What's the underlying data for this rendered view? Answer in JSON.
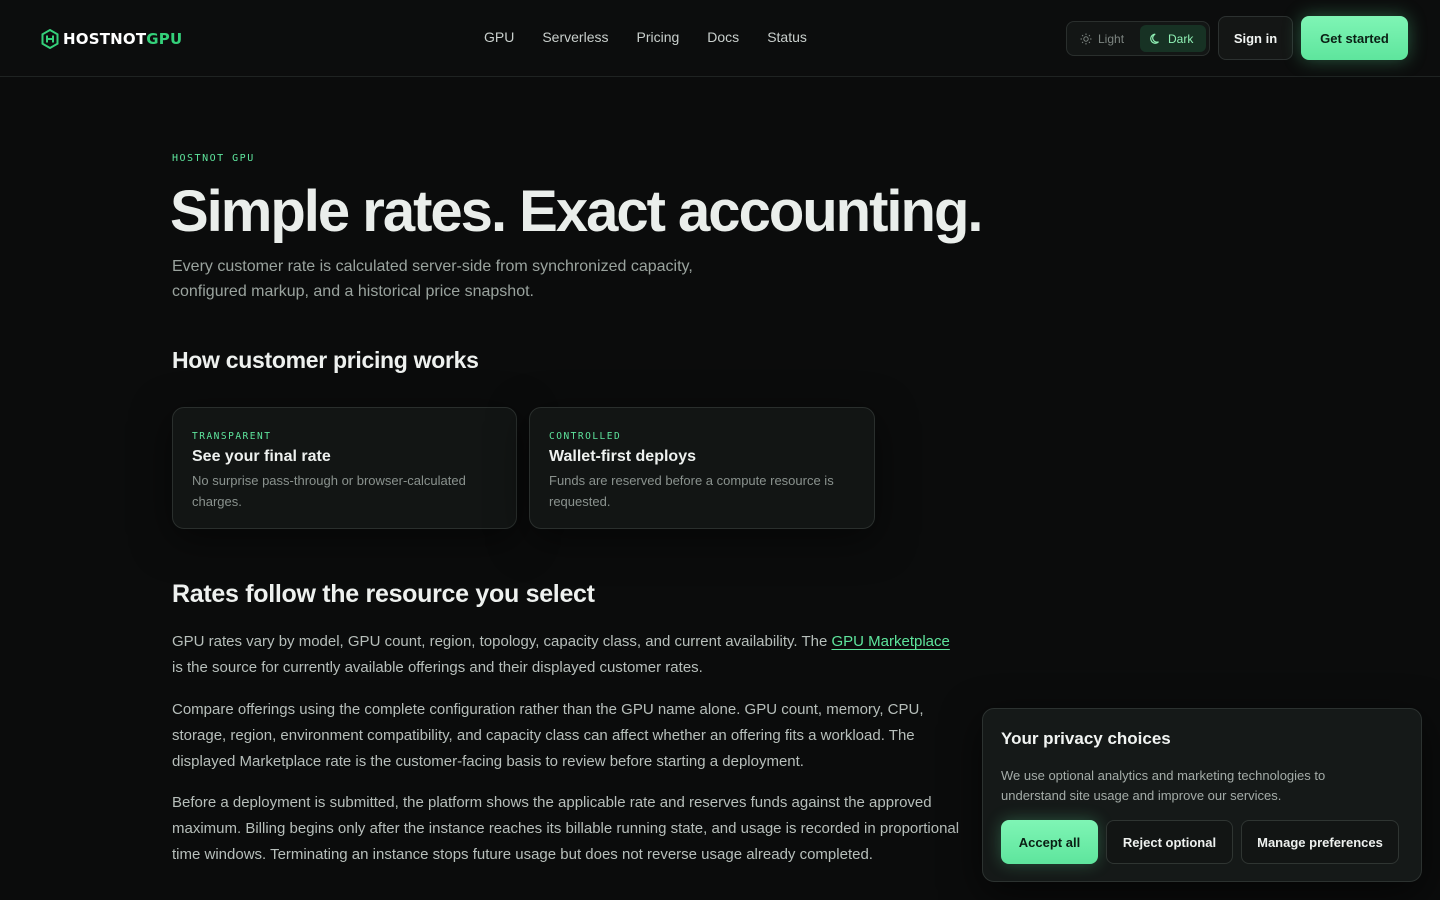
{
  "header": {
    "logo": {
      "part1": "HOSTNOT",
      "part2": "GPU",
      "icon": "hexagon-logo-icon"
    },
    "nav": [
      "GPU",
      "Serverless",
      "Pricing",
      "Docs",
      "Status"
    ],
    "theme": {
      "light_label": "Light",
      "dark_label": "Dark",
      "selected": "Dark"
    },
    "sign_in": "Sign in",
    "get_started": "Get started"
  },
  "hero": {
    "eyebrow": "HOSTNOT GPU",
    "title": "Simple rates. Exact accounting.",
    "lead": "Every customer rate is calculated server-side from synchronized capacity, configured markup, and a historical price snapshot."
  },
  "how": {
    "heading": "How customer pricing works",
    "cards": [
      {
        "tag": "TRANSPARENT",
        "title": "See your final rate",
        "desc": "No surprise pass-through or browser-calculated charges."
      },
      {
        "tag": "CONTROLLED",
        "title": "Wallet-first deploys",
        "desc": "Funds are reserved before a compute resource is requested."
      }
    ]
  },
  "rates": {
    "heading": "Rates follow the resource you select",
    "p1_before": "GPU rates vary by model, GPU count, region, topology, capacity class, and current availability. The ",
    "p1_link": "GPU Marketplace",
    "p1_after": " is the source for currently available offerings and their displayed customer rates.",
    "p2": "Compare offerings using the complete configuration rather than the GPU name alone. GPU count, memory, CPU, storage, region, environment compatibility, and capacity class can affect whether an offering fits a workload. The displayed Marketplace rate is the customer-facing basis to review before starting a deployment.",
    "p3": "Before a deployment is submitted, the platform shows the applicable rate and reserves funds against the approved maximum. Billing begins only after the instance reaches its billable running state, and usage is recorded in proportional time windows. Terminating an instance stops future usage but does not reverse usage already completed."
  },
  "privacy": {
    "title": "Your privacy choices",
    "text": "We use optional analytics and marketing technologies to understand site usage and improve our services.",
    "accept": "Accept all",
    "reject": "Reject optional",
    "manage": "Manage preferences"
  },
  "colors": {
    "accent": "#5ee59d",
    "background": "#0b0c0c",
    "text": "#eaeeeb"
  }
}
